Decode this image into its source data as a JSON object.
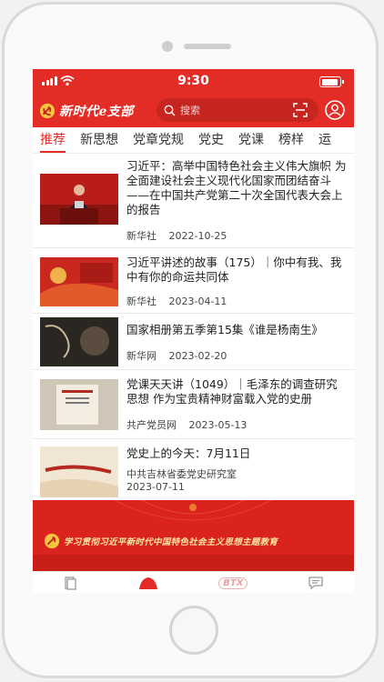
{
  "status": {
    "time": "9:30"
  },
  "header": {
    "app_name": "新时代e支部",
    "search_placeholder": "搜索"
  },
  "tabs": [
    {
      "label": "推荐",
      "active": true
    },
    {
      "label": "新思想"
    },
    {
      "label": "党章党规"
    },
    {
      "label": "党史"
    },
    {
      "label": "党课"
    },
    {
      "label": "榜样"
    },
    {
      "label": "运"
    }
  ],
  "news": [
    {
      "title": "习近平：高举中国特色社会主义伟大旗帜 为全面建设社会主义现代化国家而团结奋斗——在中国共产党第二十次全国代表大会上的报告",
      "source": "新华社",
      "date": "2022-10-25"
    },
    {
      "title": "习近平讲述的故事（175）｜你中有我、我中有你的命运共同体",
      "source": "新华社",
      "date": "2023-04-11",
      "thumb_text": "你中有我\n我中有你\n命运共同体"
    },
    {
      "title": "国家相册第五季第15集《谁是杨南生》",
      "source": "新华网",
      "date": "2023-02-20",
      "thumb_text": "谁是杨南生"
    },
    {
      "title": "党课天天讲（1049）｜毛泽东的调查研究思想 作为宝贵精神财富载入党的史册",
      "source": "共产党员网",
      "date": "2023-05-13"
    },
    {
      "title": "党史上的今天：7月11日",
      "source": "中共吉林省委党史研究室",
      "date": "2023-07-11",
      "thumb_text": "党史上的今天"
    }
  ],
  "banner": {
    "text": "学习贯彻习近平新时代中国特色社会主义思想主题教育"
  },
  "bottom_nav": [
    {
      "icon": "document-icon"
    },
    {
      "icon": "party-home-icon",
      "active": true
    },
    {
      "icon": "btx-icon",
      "label": "BTX"
    },
    {
      "icon": "message-icon"
    }
  ],
  "colors": {
    "primary": "#e42c27",
    "banner": "#d9231c",
    "gold": "#fde6a0"
  }
}
